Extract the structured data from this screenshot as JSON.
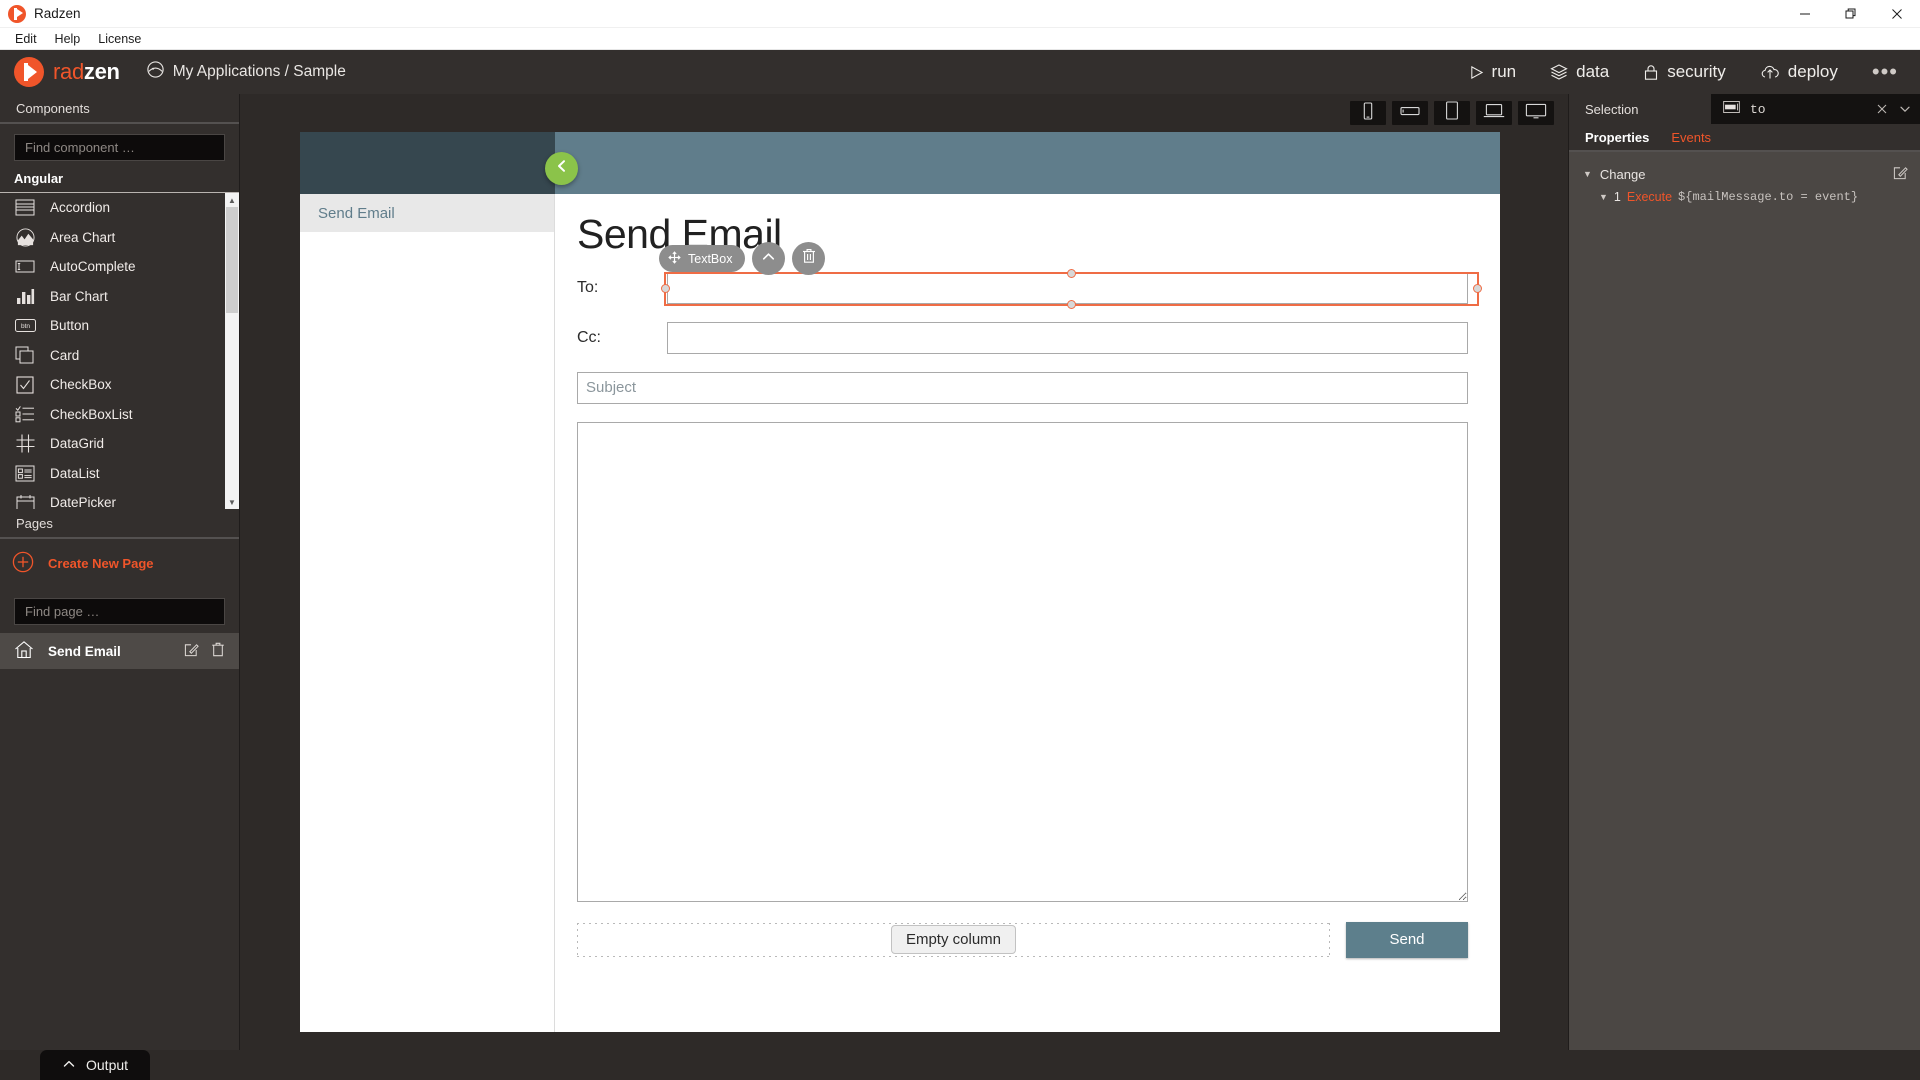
{
  "window": {
    "title": "Radzen",
    "logo_icon": "radzen-logo-icon",
    "minimize_label": "—",
    "maximize_label": "❐",
    "close_label": "✕"
  },
  "menubar": {
    "items": [
      "Edit",
      "Help",
      "License"
    ]
  },
  "appbar": {
    "brand_rad": "rad",
    "brand_zen": "zen",
    "breadcrumb_icon": "app-globe-icon",
    "breadcrumb": "My Applications / Sample",
    "actions": [
      {
        "label": "run",
        "icon": "play-triangle-icon"
      },
      {
        "label": "data",
        "icon": "layers-stack-icon"
      },
      {
        "label": "security",
        "icon": "lock-icon"
      },
      {
        "label": "deploy",
        "icon": "cloud-upload-icon"
      }
    ],
    "overflow_label": "•••"
  },
  "left_panel": {
    "header": "Components",
    "component_search_placeholder": "Find component …",
    "component_search_value": "",
    "group_label": "Angular",
    "components": [
      {
        "label": "Accordion",
        "icon": "accordion-icon"
      },
      {
        "label": "Area Chart",
        "icon": "area-chart-icon"
      },
      {
        "label": "AutoComplete",
        "icon": "autocomplete-icon"
      },
      {
        "label": "Bar Chart",
        "icon": "bar-chart-icon"
      },
      {
        "label": "Button",
        "icon": "button-icon"
      },
      {
        "label": "Card",
        "icon": "card-icon"
      },
      {
        "label": "CheckBox",
        "icon": "checkbox-icon"
      },
      {
        "label": "CheckBoxList",
        "icon": "checkboxlist-icon"
      },
      {
        "label": "DataGrid",
        "icon": "datagrid-icon"
      },
      {
        "label": "DataList",
        "icon": "datalist-icon"
      },
      {
        "label": "DatePicker",
        "icon": "datepicker-icon"
      }
    ],
    "pages_header": "Pages",
    "create_page_label": "Create New Page",
    "create_page_icon": "plus-circle-icon",
    "page_search_placeholder": "Find page …",
    "page_search_value": "",
    "pages": [
      {
        "label": "Send Email",
        "icon": "home-icon",
        "edit_icon": "edit-square-icon",
        "delete_icon": "trash-icon"
      }
    ]
  },
  "device_bar": {
    "devices": [
      {
        "name": "phone-portrait-icon",
        "title": "Phone"
      },
      {
        "name": "phone-landscape-icon",
        "title": "Phone landscape"
      },
      {
        "name": "tablet-icon",
        "title": "Tablet"
      },
      {
        "name": "laptop-icon",
        "title": "Laptop"
      },
      {
        "name": "desktop-icon",
        "title": "Desktop"
      }
    ]
  },
  "canvas": {
    "back_button_icon": "chevron-left-icon",
    "sidenav_items": [
      "Send Email"
    ],
    "page_title": "Send Email",
    "fields": [
      {
        "label": "To:",
        "value": "",
        "placeholder": "",
        "selected": true
      },
      {
        "label": "Cc:",
        "value": "",
        "placeholder": "",
        "selected": false
      }
    ],
    "subject_placeholder": "Subject",
    "subject_value": "",
    "body_value": "",
    "body_placeholder": "",
    "empty_column_label": "Empty column",
    "send_button_label": "Send",
    "colors": {
      "header_dark": "#36474f",
      "header_light": "#607d8b",
      "send_button": "#5d7f8c",
      "back_fab": "#8bc34a",
      "selection": "#ef6c45"
    }
  },
  "selection_widget": {
    "chip_label": "TextBox",
    "move_icon": "move-cross-icon",
    "parent_icon": "chevron-up-icon",
    "delete_icon": "trash-icon"
  },
  "right_panel": {
    "selection_label": "Selection",
    "selection_icon": "textbox-abc-icon",
    "selection_value": "to",
    "clear_icon": "close-x-icon",
    "expand_icon": "chevron-down-icon",
    "tabs": [
      {
        "label": "Properties",
        "active": true
      },
      {
        "label": "Events",
        "active": false
      }
    ],
    "event_groups": [
      {
        "name": "Change",
        "edit_icon": "edit-square-icon",
        "caret_icon": "caret-down-icon",
        "lines": [
          {
            "num": "1",
            "verb": "Execute",
            "code": "${mailMessage.to = event}"
          }
        ]
      }
    ]
  },
  "output": {
    "label": "Output",
    "caret_icon": "chevron-up-icon"
  }
}
